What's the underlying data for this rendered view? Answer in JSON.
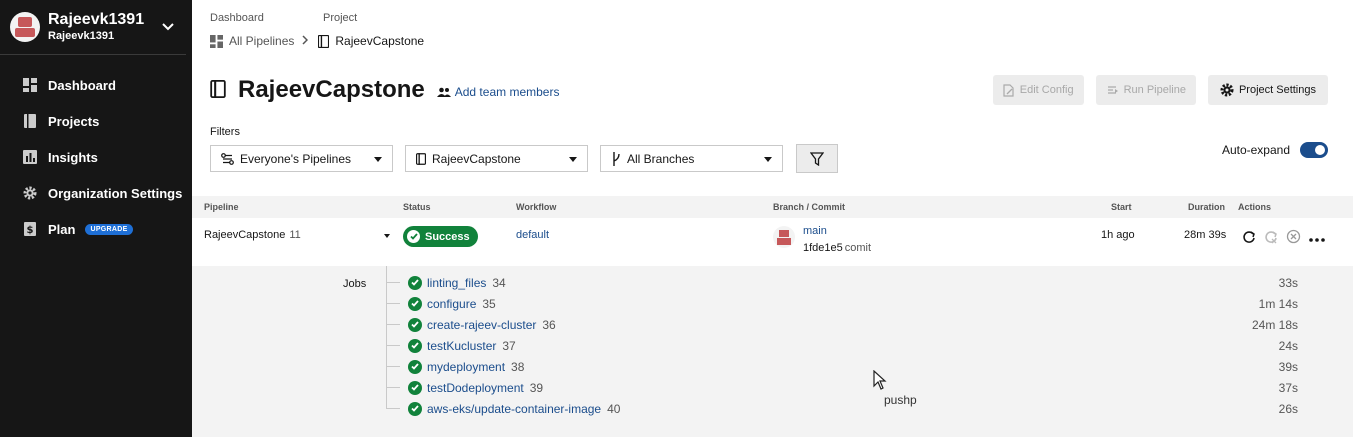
{
  "sidebar": {
    "org_name": "Rajeevk1391",
    "org_sub": "Rajeevk1391",
    "items": [
      {
        "label": "Dashboard",
        "icon": "dashboard-icon"
      },
      {
        "label": "Projects",
        "icon": "book-icon"
      },
      {
        "label": "Insights",
        "icon": "chart-icon"
      },
      {
        "label": "Organization Settings",
        "icon": "gear-icon"
      },
      {
        "label": "Plan",
        "icon": "dollar-icon",
        "badge": "UPGRADE"
      }
    ]
  },
  "breadcrumb": {
    "label_1": "Dashboard",
    "label_2": "Project",
    "link": "All Pipelines",
    "current": "RajeevCapstone"
  },
  "header": {
    "title": "RajeevCapstone",
    "add_team": "Add team members",
    "edit_config": "Edit Config",
    "run_pipeline": "Run Pipeline",
    "project_settings": "Project Settings"
  },
  "filters": {
    "label": "Filters",
    "pipelines": "Everyone's Pipelines",
    "project": "RajeevCapstone",
    "branches": "All Branches",
    "auto_expand": "Auto-expand"
  },
  "table": {
    "headers": {
      "pipeline": "Pipeline",
      "status": "Status",
      "workflow": "Workflow",
      "branch_commit": "Branch / Commit",
      "start": "Start",
      "duration": "Duration",
      "actions": "Actions"
    },
    "row": {
      "pipeline": "RajeevCapstone",
      "number": "11",
      "status": "Success",
      "workflow": "default",
      "branch": "main",
      "commit_hash": "1fde1e5",
      "commit_msg": "comit",
      "start": "1h ago",
      "duration": "28m 39s"
    },
    "jobs_label": "Jobs",
    "jobs": [
      {
        "name": "linting_files",
        "num": "34",
        "dur": "33s"
      },
      {
        "name": "configure",
        "num": "35",
        "dur": "1m 14s"
      },
      {
        "name": "create-rajeev-cluster",
        "num": "36",
        "dur": "24m 18s"
      },
      {
        "name": "testKucluster",
        "num": "37",
        "dur": "24s"
      },
      {
        "name": "mydeployment",
        "num": "38",
        "dur": "39s"
      },
      {
        "name": "testDodeployment",
        "num": "39",
        "dur": "37s"
      },
      {
        "name": "aws-eks/update-container-image",
        "num": "40",
        "dur": "26s"
      }
    ]
  },
  "tooltip": "pushp",
  "colors": {
    "success": "#11823b",
    "link": "#1b4d8c",
    "sidebar": "#161616"
  }
}
